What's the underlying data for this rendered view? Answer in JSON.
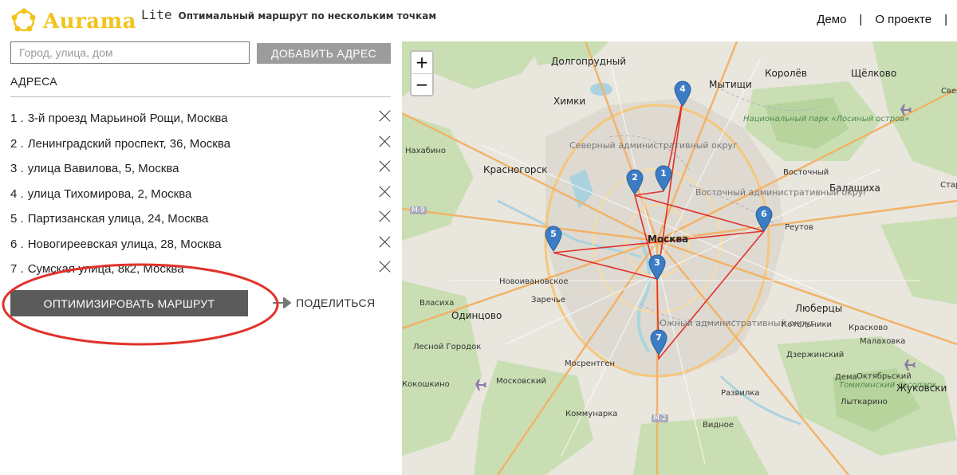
{
  "header": {
    "brand": "Aurama",
    "edition": "Lite",
    "tagline": "Оптимальный маршрут по нескольким точкам",
    "nav": [
      "Демо",
      "|",
      "О проекте",
      "|"
    ],
    "brand_color": "#f2c31a"
  },
  "search": {
    "placeholder": "Город, улица, дом",
    "add_button": "ДОБАВИТЬ АДРЕС"
  },
  "addresses": {
    "heading": "АДРЕСА",
    "items": [
      {
        "num": "1 .",
        "text": "3-й проезд Марьиной Рощи, Москва"
      },
      {
        "num": "2 .",
        "text": "Ленинградский проспект, 36, Москва"
      },
      {
        "num": "3 .",
        "text": "улица Вавилова, 5, Москва"
      },
      {
        "num": "4 .",
        "text": "улица Тихомирова, 2, Москва"
      },
      {
        "num": "5 .",
        "text": "Партизанская улица, 24, Москва"
      },
      {
        "num": "6 .",
        "text": "Новогиреевская улица, 28, Москва"
      },
      {
        "num": "7 .",
        "text": "Сумская улица, 8к2, Москва"
      }
    ]
  },
  "actions": {
    "optimize": "ОПТИМИЗИРОВАТЬ МАРШРУТ",
    "share": "ПОДЕЛИТЬСЯ"
  },
  "map": {
    "zoom_in": "+",
    "zoom_out": "−",
    "route_color": "#e0322a",
    "pin_color": "#3b7cc4",
    "pins": [
      "1",
      "2",
      "3",
      "4",
      "5",
      "6",
      "7"
    ],
    "labels": {
      "dolgoprudny": "Долгопрудный",
      "mytishchi": "Мытищи",
      "korolev": "Королёв",
      "shchelkovo": "Щёлково",
      "khimki": "Химки",
      "nakhabino": "Нахабино",
      "krasnogorsk": "Красногорск",
      "moskva": "Москва",
      "balashikha": "Балашиха",
      "reutov": "Реутов",
      "vostochny": "Восточный",
      "novoivanovskoe": "Новоивановское",
      "zarechye": "Заречье",
      "vlasikha": "Власиха",
      "odintsovo": "Одинцово",
      "lyubertsy": "Люберцы",
      "kotelniki": "Котельники",
      "kraskovo": "Красково",
      "malakhovka": "Малаховка",
      "dzerzhinsky": "Дзержинский",
      "lesnoy_gorodok": "Лесной Городок",
      "mosrentgen": "Мосрентген",
      "dema": "Дема",
      "oktyabrsky": "Октябрьский",
      "lytkarino": "Лыткарино",
      "zhukovsky": "Жуковски",
      "kokoshkino": "Кокошкино",
      "moskovsky": "Московский",
      "razvilka": "Развилка",
      "kommunarka": "Коммунарка",
      "vidnoe": "Видное",
      "north_district": "Северный административный округ",
      "east_district": "Восточный административный округ",
      "south_district": "Южный административный округ",
      "losiny_park": "Национальный парк «Лосиный остров»",
      "tomilinsky": "Томилинский лесопарк",
      "m9": "М-9",
      "m2": "М-2",
      "sverdl": "Свердл",
      "star": "Стар"
    }
  }
}
